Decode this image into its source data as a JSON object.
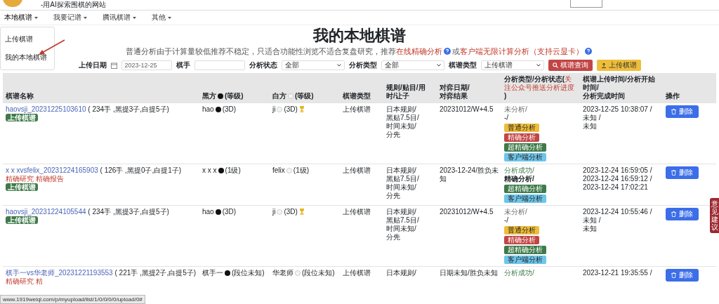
{
  "header": {
    "tagline": "-用AI探索围棋的网站"
  },
  "nav": [
    {
      "label": "本地棋谱",
      "expanded": true
    },
    {
      "label": "我要记谱",
      "expanded": false
    },
    {
      "label": "腾讯棋谱",
      "expanded": false
    },
    {
      "label": "其他",
      "expanded": false
    }
  ],
  "dropdown": [
    "上传棋谱",
    "我的本地棋谱"
  ],
  "page": {
    "title": "我的本地棋谱",
    "notice": "普通分析由于计算量较低推荐不稳定，只适合功能性浏览不适合复盘研究，推荐",
    "link_1": "在线精确分析",
    "joiner": "或",
    "link_2": "客户端无限计算分析（支持云显卡）"
  },
  "filters": [
    {
      "kind": "date",
      "label": "上传日期",
      "value": "2023-12-25"
    },
    {
      "kind": "text",
      "label": "棋手"
    },
    {
      "kind": "select",
      "label": "分析状态",
      "value": "全部"
    },
    {
      "kind": "select",
      "label": "分析类型",
      "value": "全部"
    },
    {
      "kind": "select",
      "label": "棋谱类型",
      "value": "上传棋谱"
    }
  ],
  "filter_buttons": [
    {
      "kind": "search",
      "label": "棋谱查询"
    },
    {
      "kind": "upload",
      "label": "上传棋谱"
    }
  ],
  "table": {
    "columns": [
      {
        "kind": "text",
        "lines": [
          "棋谱名称"
        ]
      },
      {
        "kind": "black",
        "label": "黑方",
        "suffix": "(等级)"
      },
      {
        "kind": "white",
        "label": "白方",
        "suffix": "(等级)"
      },
      {
        "kind": "text",
        "lines": [
          "棋谱类型"
        ]
      },
      {
        "kind": "text",
        "lines": [
          "规则/贴目/用时/让子"
        ]
      },
      {
        "kind": "text",
        "lines": [
          "对弈日期/",
          "对弈结果"
        ]
      },
      {
        "kind": "note",
        "label": "分析类型/分析状态(",
        "note": "关注公众号推送分析进度",
        "suffix": " )"
      },
      {
        "kind": "text",
        "lines": [
          "棋谱上传时间/分析开始时间/",
          "分析完成时间"
        ]
      },
      {
        "kind": "text",
        "lines": [
          "操作"
        ]
      }
    ],
    "rows": [
      {
        "name": "haovsji_20231225103610",
        "stats": "( 234手 ,黑提3子,白提5子)",
        "links": [],
        "badge": "上传棋谱",
        "black": "hao",
        "black_rank": "(3D)",
        "white": "ji",
        "white_rank": "(3D)",
        "winner_white": true,
        "type": "上传棋谱",
        "rules": [
          "日本规则/",
          "黑贴7.5目/",
          "时间未知/",
          "分先"
        ],
        "result": "20231012/W+4.5",
        "analyzed": false,
        "status": "未分析/",
        "analysis": "-/",
        "analysis_bold": false,
        "actions": [
          {
            "kind": "normal",
            "label": "普通分析"
          },
          {
            "kind": "precise",
            "label": "精确分析"
          },
          {
            "kind": "super",
            "label": "超精确分析"
          },
          {
            "kind": "client",
            "label": "客户端分析"
          }
        ],
        "times": [
          "2023-12-25 10:38:07 /",
          "未知 /",
          "未知"
        ],
        "delete": "删除"
      },
      {
        "name": "x x xvsfelix_20231224165903",
        "stats": "( 126手 ,黑提0子,白提1子)",
        "links": [
          "精确研究",
          "精确报告"
        ],
        "badge": "上传棋谱",
        "black": "x x x",
        "black_rank": "(1级)",
        "white": "felix",
        "white_rank": "(1级)",
        "winner_white": false,
        "type": "上传棋谱",
        "rules": [
          "日本规则/",
          "黑贴7.5目/",
          "时间未知/",
          "分先"
        ],
        "result": "2023-12-24/胜负未知",
        "analyzed": true,
        "status": "分析成功/",
        "analysis": "精确分析/",
        "analysis_bold": true,
        "actions": [
          {
            "kind": "super",
            "label": "超精确分析"
          },
          {
            "kind": "client",
            "label": "客户端分析"
          }
        ],
        "times": [
          "2023-12-24 16:59:05 /",
          "2023-12-24 16:59:12 /",
          "2023-12-24 17:02:21"
        ],
        "delete": "删除"
      },
      {
        "name": "haovsji_20231224105544",
        "stats": "( 234手 ,黑提3子,白提5子)",
        "links": [],
        "badge": "上传棋谱",
        "black": "hao",
        "black_rank": "(3D)",
        "white": "ji",
        "white_rank": "(3D)",
        "winner_white": true,
        "type": "上传棋谱",
        "rules": [
          "日本规则/",
          "黑贴7.5目/",
          "时间未知/",
          "分先"
        ],
        "result": "20231012/W+4.5",
        "analyzed": false,
        "status": "未分析/",
        "analysis": "-/",
        "analysis_bold": false,
        "actions": [
          {
            "kind": "normal",
            "label": "普通分析"
          },
          {
            "kind": "precise",
            "label": "精确分析"
          },
          {
            "kind": "super",
            "label": "超精确分析"
          },
          {
            "kind": "client",
            "label": "客户端分析"
          }
        ],
        "times": [
          "2023-12-24 10:55:46 /",
          "未知 /",
          "未知"
        ],
        "delete": "删除"
      },
      {
        "name": "棋手一vs华老师_20231221193553",
        "stats": "( 221手 ,黑提2子,白提5子)",
        "links": [
          "精确研究",
          "精"
        ],
        "black": "棋手一",
        "black_rank": "(段位未知)",
        "white": "华老师",
        "white_rank": "(段位未知)",
        "winner_white": false,
        "type": "上传棋谱",
        "rules": [
          "日本规则/"
        ],
        "result": "日期未知/胜负未知",
        "analyzed": true,
        "status": "分析成功/",
        "actions": [],
        "times": [
          "2023-12-21 19:35:55 /"
        ],
        "delete": "删除"
      }
    ]
  },
  "feedback_tab": "意见建议",
  "status_bar": "www.1919weiqi.com/p/myupload/list/1/0/0/0/0/upload/0#"
}
